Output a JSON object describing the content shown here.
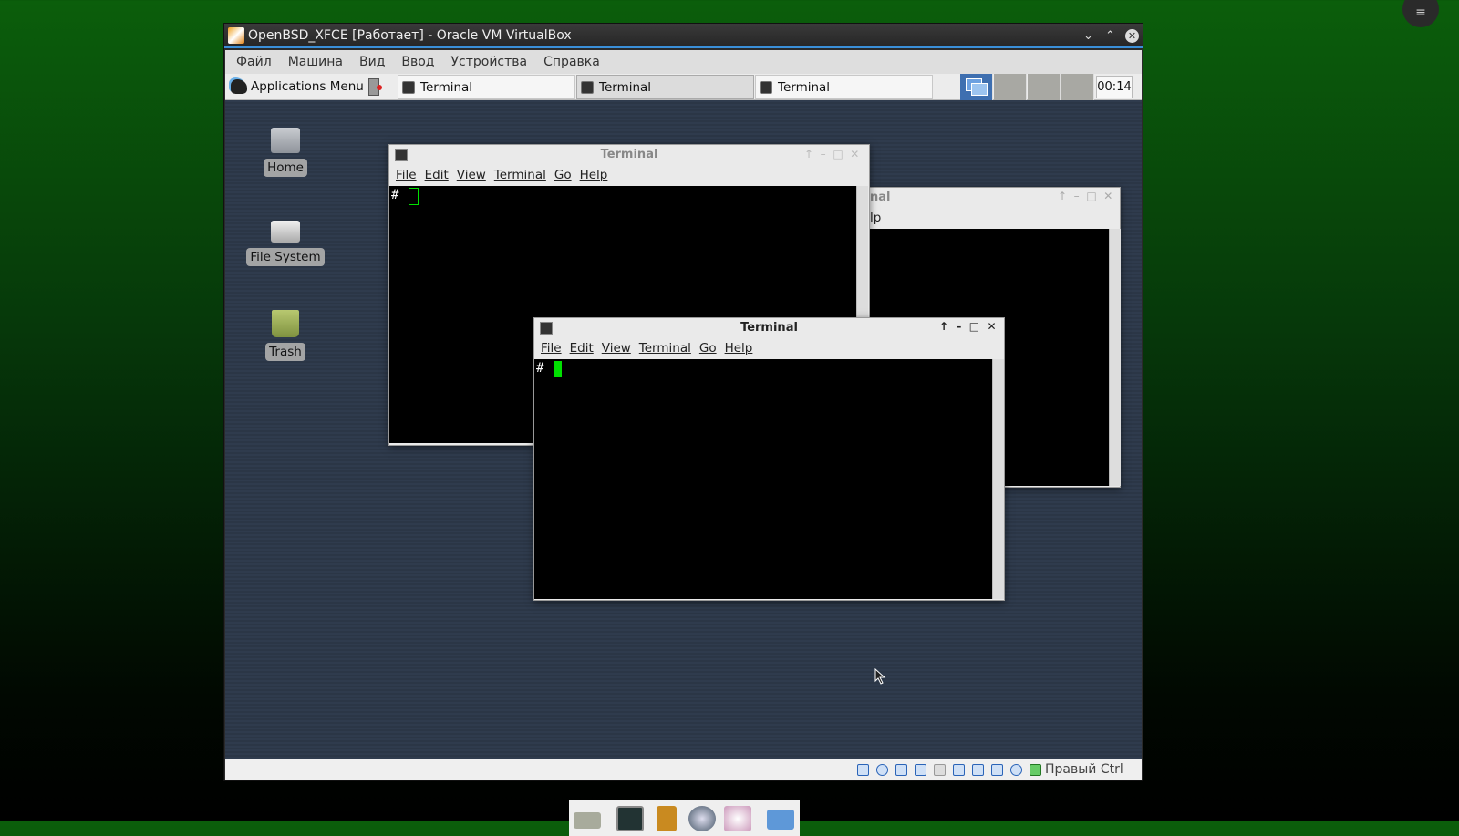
{
  "vm": {
    "title": "OpenBSD_XFCE [Работает] - Oracle VM VirtualBox",
    "menu": [
      "Файл",
      "Машина",
      "Вид",
      "Ввод",
      "Устройства",
      "Справка"
    ],
    "status_text": "Правый Ctrl"
  },
  "panel": {
    "apps_menu": "Applications Menu",
    "tasks": [
      "Terminal",
      "Terminal",
      "Terminal"
    ],
    "clock": "00:14"
  },
  "desktop": {
    "icons": [
      "Home",
      "File System",
      "Trash"
    ]
  },
  "terminal": {
    "title": "Terminal",
    "menu": [
      "File",
      "Edit",
      "View",
      "Terminal",
      "Go",
      "Help"
    ],
    "prompt": "#"
  },
  "back_terminal": {
    "title_fragment": "nal",
    "menu_fragment": "lp"
  },
  "colors": {
    "cursor": "#00e000",
    "accent": "#3a8fd8",
    "desktop": "#2e3a4c"
  }
}
